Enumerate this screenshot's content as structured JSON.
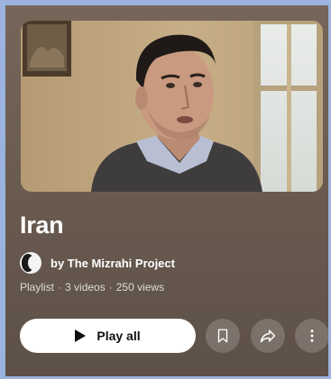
{
  "playlist": {
    "title": "Iran",
    "owner_label": "by The Mizrahi Project",
    "type": "Playlist",
    "separator": "·",
    "video_count": "3 videos",
    "view_count": "250 views"
  },
  "actions": {
    "play_all_label": "Play all",
    "play_icon": "play-icon",
    "save_icon": "bookmark-icon",
    "share_icon": "share-icon",
    "more_icon": "more-vert-icon"
  },
  "colors": {
    "background_gradient_top": "#76665a",
    "background_gradient_bottom": "#5d5048",
    "play_button": "#ffffff",
    "text": "#ffffff"
  }
}
